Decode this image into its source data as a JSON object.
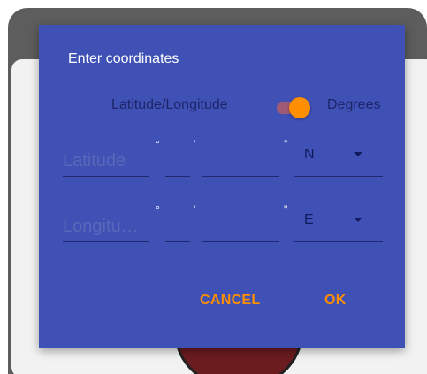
{
  "dialog": {
    "title": "Enter coordinates",
    "toggle": {
      "left_label": "Latitude/Longitude",
      "right_label": "Degrees",
      "state": "on"
    },
    "latitude": {
      "placeholder": "Latitude",
      "degree_symbol": "°",
      "minute_symbol": "'",
      "second_symbol": "\"",
      "hemisphere": "N"
    },
    "longitude": {
      "placeholder": "Longitu…",
      "degree_symbol": "°",
      "minute_symbol": "'",
      "second_symbol": "\"",
      "hemisphere": "E"
    },
    "buttons": {
      "cancel": "CANCEL",
      "ok": "OK"
    }
  },
  "colors": {
    "dialog_bg": "#3f51b5",
    "accent": "#ff8f00",
    "scrim": "#5d5d5d"
  }
}
